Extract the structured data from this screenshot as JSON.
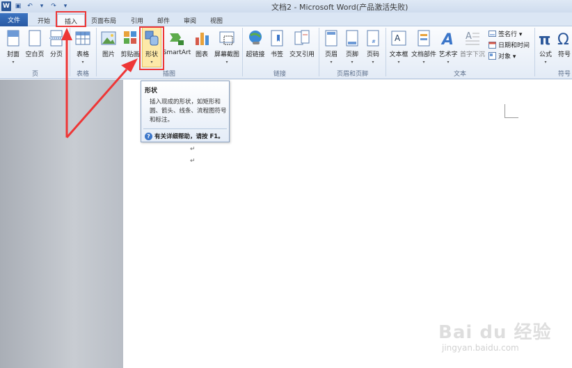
{
  "window": {
    "title": "文档2 - Microsoft Word(产品激活失败)"
  },
  "qat": {
    "logo": "W",
    "save": "▣",
    "undo": "↶",
    "redo": "↷",
    "more": "▾"
  },
  "tabs": [
    {
      "label": "文件"
    },
    {
      "label": "开始"
    },
    {
      "label": "插入"
    },
    {
      "label": "页面布局"
    },
    {
      "label": "引用"
    },
    {
      "label": "邮件"
    },
    {
      "label": "审阅"
    },
    {
      "label": "视图"
    }
  ],
  "ribbon": {
    "buttons": {
      "cover": "封面",
      "blank": "空白页",
      "break": "分页",
      "table": "表格",
      "picture": "图片",
      "clipart": "剪贴画",
      "shapes": "形状",
      "smartart": "SmartArt",
      "chart": "图表",
      "screenshot": "屏幕截图",
      "hyperlink": "超链接",
      "bookmark": "书签",
      "crossref": "交叉引用",
      "header": "页眉",
      "footer": "页脚",
      "pagenum": "页码",
      "textbox": "文本框",
      "quickparts": "文档部件",
      "wordart": "艺术字",
      "dropcap": "首字下沉",
      "signature": "签名行 ▾",
      "datetime": "日期和时间",
      "object": "对象 ▾",
      "equation": "公式",
      "symbol": "符号"
    },
    "groups": {
      "pages": "页",
      "tables": "表格",
      "illustrations": "插图",
      "links": "链接",
      "headerfooter": "页眉和页脚",
      "text": "文本",
      "symbols": "符号"
    },
    "dropdown_arrow": "▾"
  },
  "tooltip": {
    "title": "形状",
    "description": "插入现成的形状，如矩形和圆、箭头、线条、流程图符号和标注。",
    "help_icon": "?",
    "help": "有关详细帮助，请按 F1。"
  },
  "document": {
    "para_mark": "↵"
  },
  "watermark": {
    "brand": "Bai du 经验",
    "url": "jingyan.baidu.com"
  },
  "colors": {
    "highlight": "#ee3636",
    "file_tab": "#2a5aa3",
    "ribbon_bg": "#e3ebf6"
  }
}
